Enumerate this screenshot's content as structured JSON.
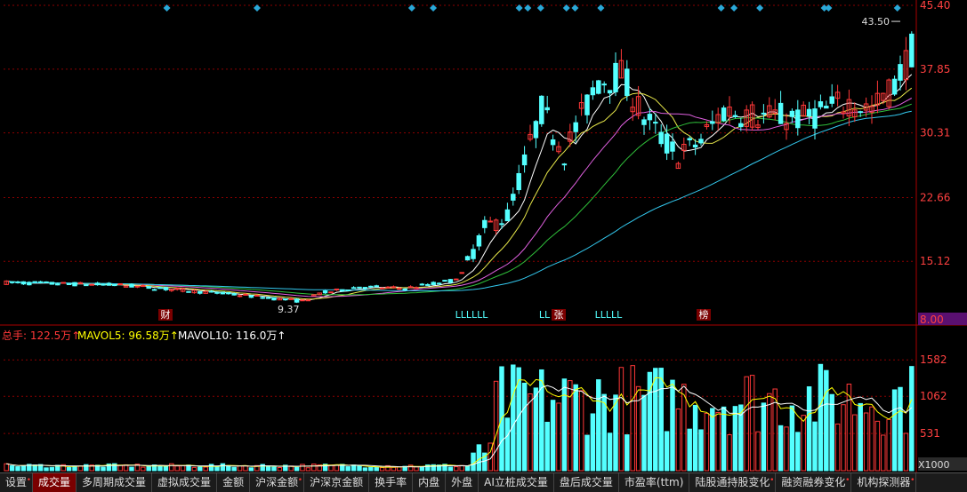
{
  "chart_data": [
    {
      "type": "candlestick",
      "title": "",
      "ylim": [
        8.0,
        45.4
      ],
      "y_ticks": [
        "45.40",
        "37.85",
        "30.31",
        "22.66",
        "15.12",
        "8.00"
      ],
      "high_label": "43.50",
      "low_label": "9.37",
      "ma_series": [
        {
          "name": "MA5",
          "color": "#ffffff"
        },
        {
          "name": "MA10",
          "color": "#e8e84a"
        },
        {
          "name": "MA20",
          "color": "#e060e0"
        },
        {
          "name": "MA30",
          "color": "#2fbf3a"
        },
        {
          "name": "MA60",
          "color": "#33c8ee"
        }
      ],
      "markers": [
        "财",
        "LLLLLL",
        "LL",
        "张",
        "LLLLL",
        "榜"
      ],
      "colors": {
        "up": "#ff3838",
        "down": "#54ffff",
        "grid": "#8b0000"
      }
    },
    {
      "type": "bar",
      "title": "",
      "legend": [
        {
          "text": "总手: 122.5万↑",
          "color": "#ff3838"
        },
        {
          "text": "MAVOL5: 96.58万↑",
          "color": "#ffff00"
        },
        {
          "text": "MAVOL10: 116.0万↑",
          "color": "#ffffff"
        }
      ],
      "ylim": [
        0,
        1800
      ],
      "y_ticks": [
        "1582",
        "1062",
        "531"
      ],
      "unit_label": "X1000"
    }
  ],
  "toolbar": {
    "tabs": [
      {
        "label": "设置",
        "dot": true,
        "active": false
      },
      {
        "label": "成交量",
        "dot": false,
        "active": true
      },
      {
        "label": "多周期成交量",
        "dot": false,
        "active": false
      },
      {
        "label": "虚拟成交量",
        "dot": false,
        "active": false
      },
      {
        "label": "金额",
        "dot": false,
        "active": false
      },
      {
        "label": "沪深金额",
        "dot": true,
        "active": false
      },
      {
        "label": "沪深京金额",
        "dot": false,
        "active": false
      },
      {
        "label": "换手率",
        "dot": false,
        "active": false
      },
      {
        "label": "内盘",
        "dot": false,
        "active": false
      },
      {
        "label": "外盘",
        "dot": false,
        "active": false
      },
      {
        "label": "AI立桩成交量",
        "dot": false,
        "active": false
      },
      {
        "label": "盘后成交量",
        "dot": false,
        "active": false
      },
      {
        "label": "市盈率(ttm)",
        "dot": false,
        "active": false
      },
      {
        "label": "陆股通持股变化",
        "dot": true,
        "active": false
      },
      {
        "label": "融资融券变化",
        "dot": true,
        "active": false
      },
      {
        "label": "机构探测器",
        "dot": true,
        "active": false
      }
    ]
  }
}
